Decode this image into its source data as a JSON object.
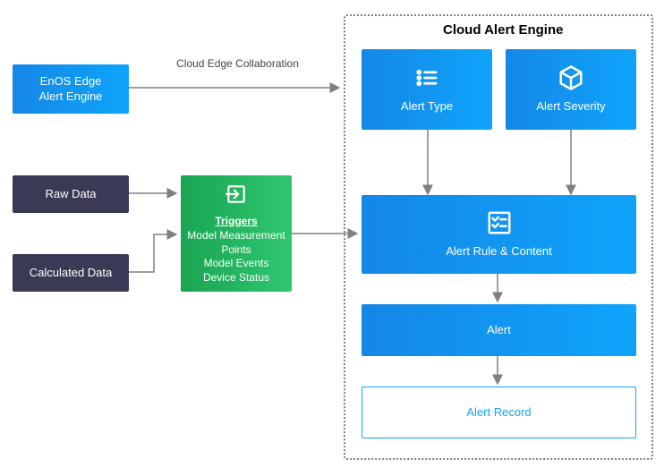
{
  "container": {
    "title": "Cloud Alert Engine"
  },
  "edge_label": "Cloud Edge Collaboration",
  "nodes": {
    "edge_engine": {
      "line1": "EnOS Edge",
      "line2": "Alert Engine"
    },
    "raw_data": "Raw Data",
    "calc_data": "Calculated Data",
    "triggers": {
      "title": "Triggers",
      "line1": "Model Measurement",
      "line2": "Points",
      "line3": "Model Events",
      "line4": "Device Status"
    },
    "alert_type": "Alert Type",
    "alert_severity": "Alert Severity",
    "alert_rule": "Alert Rule & Content",
    "alert": "Alert",
    "alert_record": "Alert Record"
  }
}
